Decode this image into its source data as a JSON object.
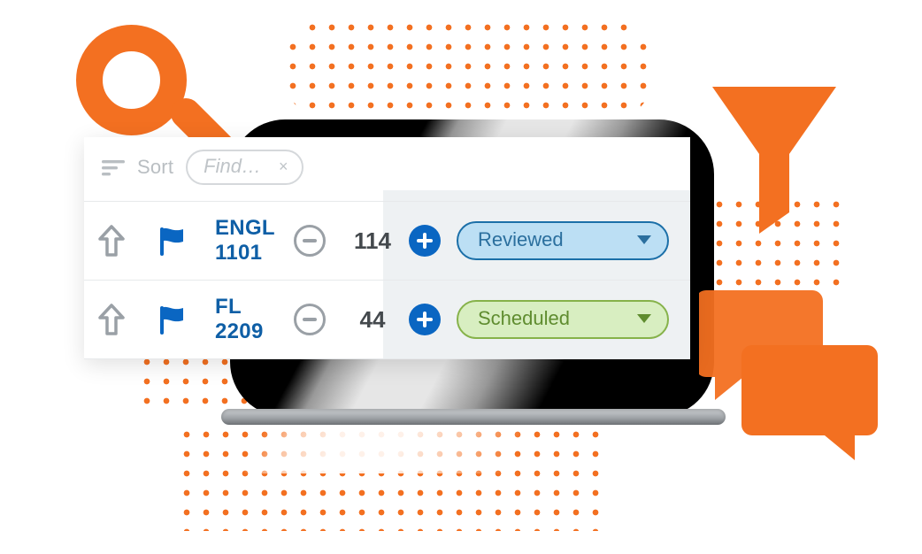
{
  "toolbar": {
    "sort_label": "Sort",
    "find_placeholder": "Find…"
  },
  "rows": [
    {
      "course": "ENGL 1101",
      "count": "114",
      "status_label": "Reviewed",
      "status_kind": "reviewed"
    },
    {
      "course": "FL 2209",
      "count": "44",
      "status_label": "Scheduled",
      "status_kind": "scheduled"
    }
  ],
  "colors": {
    "orange": "#f37021",
    "blue_text": "#0f5fa6",
    "plus_bg": "#0a66c2",
    "reviewed_bg": "#bcdff4",
    "reviewed_border": "#1b6fa8",
    "scheduled_bg": "#d8eec1",
    "scheduled_border": "#86b24a"
  }
}
